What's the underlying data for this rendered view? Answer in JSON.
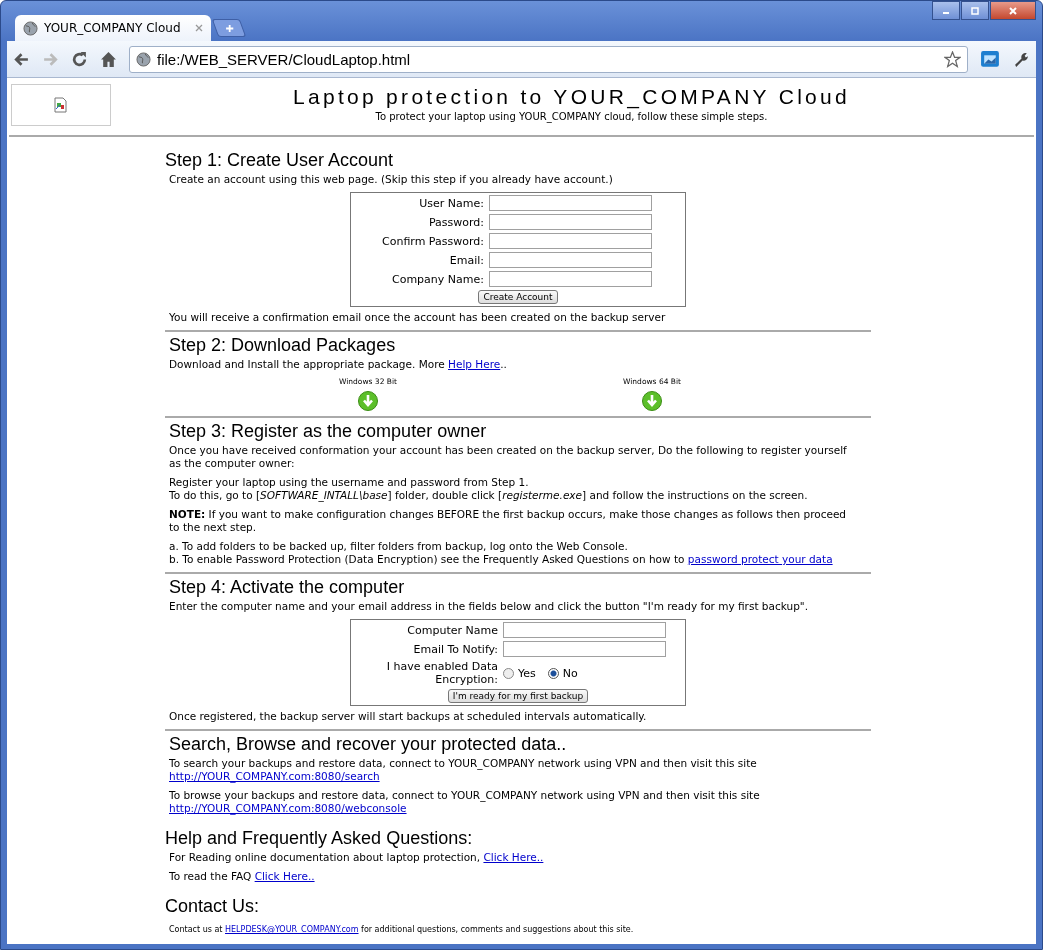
{
  "browser": {
    "tab_title": "YOUR_COMPANY Cloud",
    "url": "file:/WEB_SERVER/CloudLaptop.html"
  },
  "header": {
    "title": "Laptop protection to YOUR_COMPANY Cloud",
    "subtitle": "To protect your laptop using YOUR_COMPANY cloud, follow these simple steps."
  },
  "sections": [
    {
      "heading": "Step 1: Create User Account",
      "rule": false,
      "blocks": [
        {
          "kind": "paragraph",
          "parts": [
            {
              "kind": "text",
              "text": "Create an account using this web page. (Skip this step if you already have account.)"
            }
          ]
        },
        {
          "kind": "form",
          "fields": [
            {
              "label": "User Name:"
            },
            {
              "label": "Password:"
            },
            {
              "label": "Confirm Password:"
            },
            {
              "label": "Email:"
            },
            {
              "label": "Company Name:"
            }
          ],
          "button": "Create Account"
        },
        {
          "kind": "paragraph",
          "parts": [
            {
              "kind": "text",
              "text": "You will receive a confirmation email once the account has been created on the backup server"
            }
          ]
        }
      ]
    },
    {
      "heading": "Step 2: Download Packages",
      "rule": true,
      "blocks": [
        {
          "kind": "paragraph",
          "parts": [
            {
              "kind": "text",
              "text": "Download and Install the appropriate package. More "
            },
            {
              "kind": "link",
              "text": "Help Here"
            },
            {
              "kind": "text",
              "text": ".."
            }
          ]
        },
        {
          "kind": "downloads",
          "items": [
            {
              "label": "Windows 32 Bit"
            },
            {
              "label": "Windows 64 Bit"
            }
          ]
        }
      ]
    },
    {
      "heading": "Step 3: Register as the computer owner",
      "rule": true,
      "blocks": [
        {
          "kind": "paragraph",
          "parts": [
            {
              "kind": "text",
              "text": "Once you have received conformation your account has been created on the backup server, Do the following to register yourself as the computer owner:"
            }
          ]
        },
        {
          "kind": "paragraph",
          "parts": [
            {
              "kind": "text",
              "text": "Register your laptop using the username and password from Step 1."
            },
            {
              "kind": "break"
            },
            {
              "kind": "text",
              "text": "To do this, go to [*SOFTWARE_INTALL\\base*] folder, double click [*registerme.exe*] and follow the instructions on the screen."
            }
          ]
        },
        {
          "kind": "paragraph",
          "parts": [
            {
              "kind": "text",
              "text": "**NOTE:** If you want to make configuration changes BEFORE the first backup occurs, make those changes as follows then proceed to the next step."
            }
          ]
        },
        {
          "kind": "paragraph",
          "parts": [
            {
              "kind": "text",
              "text": "a. To add folders to be backed up, filter folders from backup, log onto the Web Console."
            },
            {
              "kind": "break"
            },
            {
              "kind": "text",
              "text": "b. To enable Password Protection (Data Encryption) see the Frequently Asked Questions on how to "
            },
            {
              "kind": "link",
              "text": "password protect your data"
            }
          ]
        }
      ]
    },
    {
      "heading": "Step 4: Activate the computer",
      "rule": true,
      "blocks": [
        {
          "kind": "paragraph",
          "parts": [
            {
              "kind": "text",
              "text": "Enter the computer name and your email address in the fields below and click the button \"I'm ready for my first backup\"."
            }
          ]
        },
        {
          "kind": "form",
          "fields": [
            {
              "label": "Computer Name"
            },
            {
              "label": "Email To Notify:"
            }
          ],
          "radio": {
            "label": "I have enabled Data Encryption:",
            "options": [
              {
                "label": "Yes",
                "selected": false
              },
              {
                "label": "No",
                "selected": true
              }
            ]
          },
          "button": "I'm ready for my first backup"
        },
        {
          "kind": "paragraph",
          "parts": [
            {
              "kind": "text",
              "text": "Once registered, the backup server will start backups at scheduled intervals automatically."
            }
          ]
        }
      ]
    },
    {
      "heading": "Search, Browse and recover your protected data..",
      "rule": true,
      "blocks": [
        {
          "kind": "paragraph",
          "parts": [
            {
              "kind": "text",
              "text": "To search your backups and restore data, connect to YOUR_COMPANY network using VPN and then visit this site"
            },
            {
              "kind": "break"
            },
            {
              "kind": "link",
              "text": "http://YOUR_COMPANY.com:8080/search"
            }
          ]
        },
        {
          "kind": "paragraph",
          "parts": [
            {
              "kind": "text",
              "text": "To browse your backups and restore data, connect to YOUR_COMPANY network using VPN and then visit this site"
            },
            {
              "kind": "break"
            },
            {
              "kind": "link",
              "text": "http://YOUR_COMPANY.com:8080/webconsole"
            }
          ]
        }
      ]
    },
    {
      "heading": "Help and Frequently Asked Questions:",
      "rule": false,
      "blocks": [
        {
          "kind": "paragraph",
          "parts": [
            {
              "kind": "text",
              "text": "For Reading online documentation about laptop protection, "
            },
            {
              "kind": "link",
              "text": "Click Here.."
            }
          ]
        },
        {
          "kind": "paragraph",
          "parts": [
            {
              "kind": "text",
              "text": "To read the FAQ "
            },
            {
              "kind": "link",
              "text": "Click Here.."
            }
          ]
        }
      ]
    },
    {
      "heading": "Contact Us:",
      "rule": false,
      "blocks": [
        {
          "kind": "small",
          "parts": [
            {
              "kind": "text",
              "text": "Contact us at "
            },
            {
              "kind": "link",
              "text": "HELPDESK@YOUR_COMPANY.com"
            },
            {
              "kind": "text",
              "text": " for additional questions, comments and suggestions about this site."
            }
          ]
        }
      ]
    }
  ]
}
